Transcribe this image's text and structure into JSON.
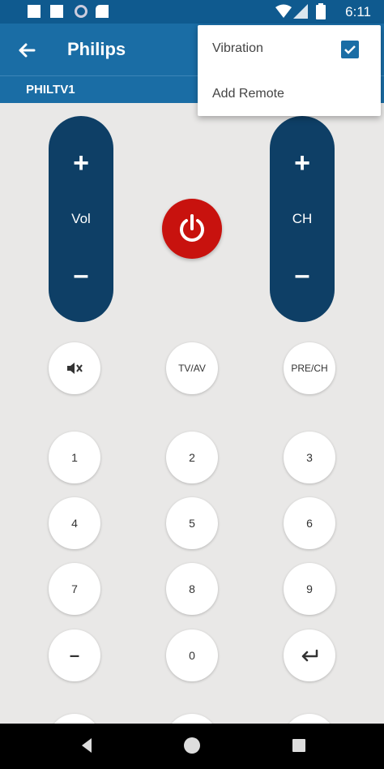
{
  "status_bar": {
    "time": "6:11"
  },
  "app_bar": {
    "title": "Philips"
  },
  "sub_bar": {
    "remote_name": "PHILTV1"
  },
  "remote": {
    "vol": {
      "plus": "+",
      "label": "Vol",
      "minus": "–"
    },
    "ch": {
      "plus": "+",
      "label": "CH",
      "minus": "–"
    },
    "tv_av": "TV/AV",
    "pre_ch": "PRE/CH",
    "digits": [
      "1",
      "2",
      "3",
      "4",
      "5",
      "6",
      "7",
      "8",
      "9"
    ],
    "dash": "–",
    "zero": "0"
  },
  "menu": {
    "vibration": "Vibration",
    "vibration_checked": true,
    "add_remote": "Add Remote"
  },
  "colors": {
    "primary": "#1a6da5",
    "pill": "#0e3f66",
    "power": "#c8120e",
    "background": "#e9e8e7"
  }
}
